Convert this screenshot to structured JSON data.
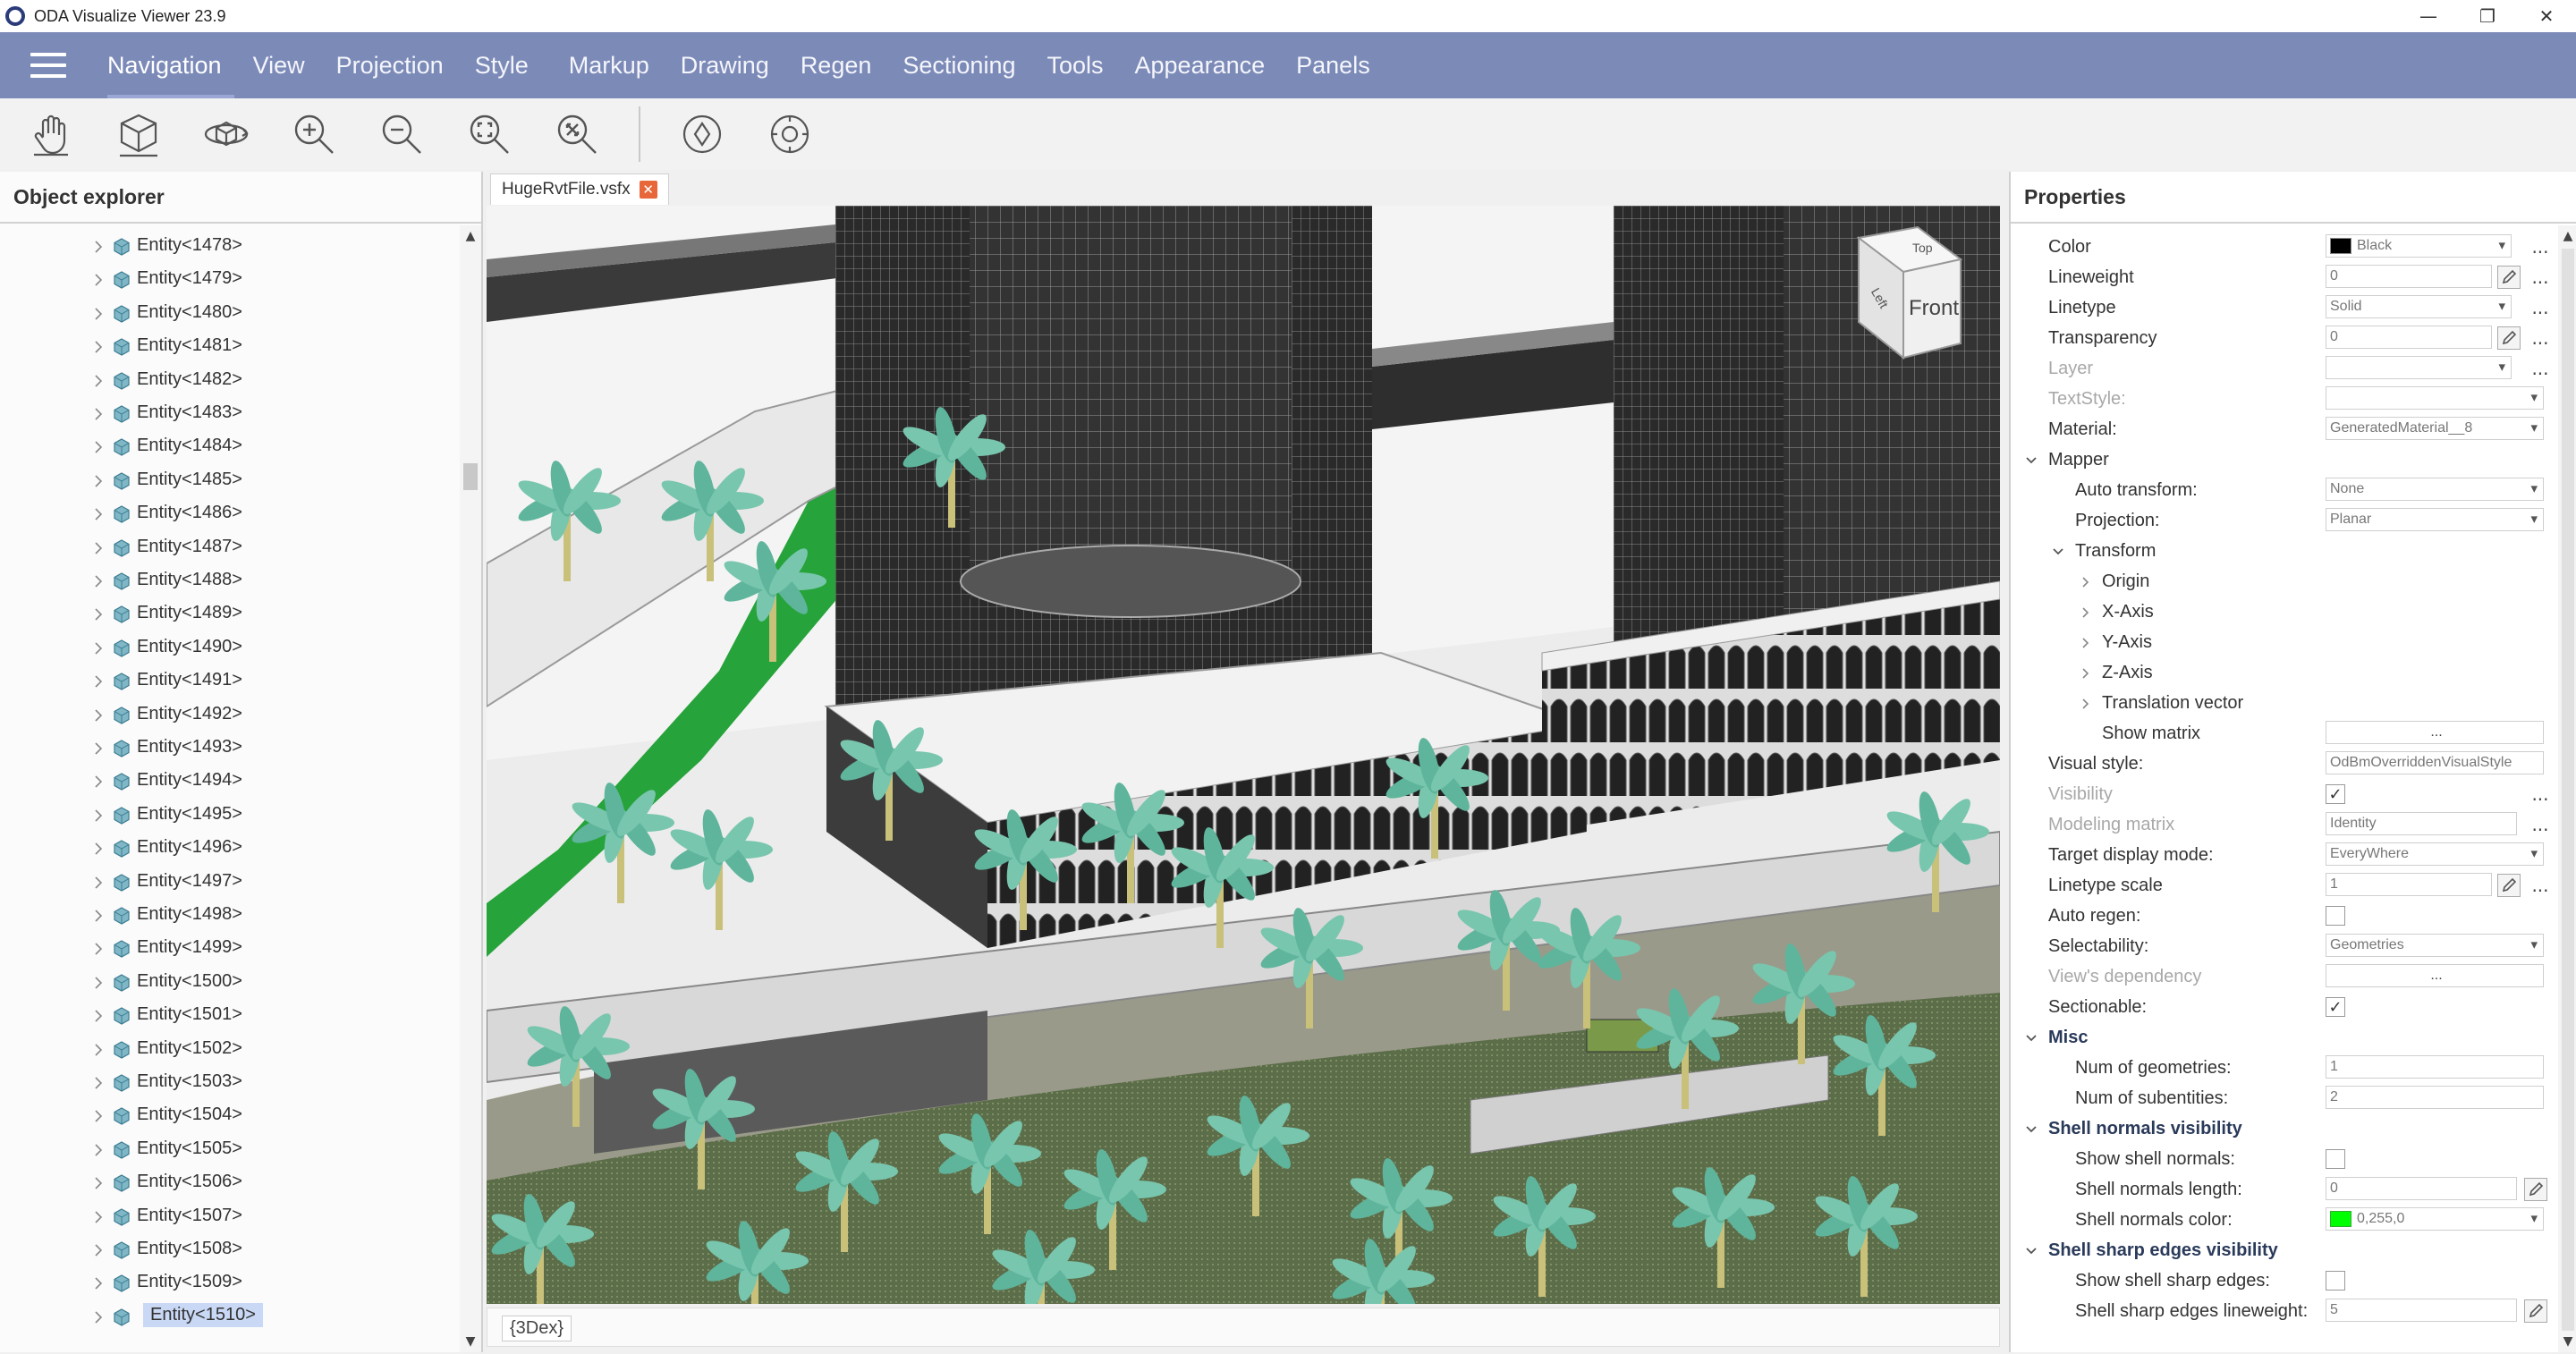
{
  "window": {
    "title": "ODA Visualize Viewer 23.9",
    "controls": {
      "minimize": "—",
      "restore": "❐",
      "close": "✕"
    }
  },
  "menu": {
    "items": [
      "Navigation",
      "View",
      "Projection",
      "Style",
      "Markup",
      "Drawing",
      "Regen",
      "Sectioning",
      "Tools",
      "Appearance",
      "Panels"
    ],
    "active": "Navigation"
  },
  "toolbar": {
    "tools": [
      "pan-hand-icon",
      "3d-box-icon",
      "orbit-icon",
      "zoom-in-icon",
      "zoom-out-icon",
      "zoom-window-icon",
      "zoom-extents-icon",
      "walk-icon",
      "turntable-icon"
    ]
  },
  "object_explorer": {
    "title": "Object explorer",
    "items": [
      "Entity<1478>",
      "Entity<1479>",
      "Entity<1480>",
      "Entity<1481>",
      "Entity<1482>",
      "Entity<1483>",
      "Entity<1484>",
      "Entity<1485>",
      "Entity<1486>",
      "Entity<1487>",
      "Entity<1488>",
      "Entity<1489>",
      "Entity<1490>",
      "Entity<1491>",
      "Entity<1492>",
      "Entity<1493>",
      "Entity<1494>",
      "Entity<1495>",
      "Entity<1496>",
      "Entity<1497>",
      "Entity<1498>",
      "Entity<1499>",
      "Entity<1500>",
      "Entity<1501>",
      "Entity<1502>",
      "Entity<1503>",
      "Entity<1504>",
      "Entity<1505>",
      "Entity<1506>",
      "Entity<1507>",
      "Entity<1508>",
      "Entity<1509>",
      "Entity<1510>"
    ],
    "selected": "Entity<1510>"
  },
  "viewport": {
    "tab_label": "HugeRvtFile.vsfx",
    "tab_close": "✕",
    "view_label": "{3Dex}",
    "viewcube": {
      "top": "Top",
      "front": "Front",
      "left": "Left"
    }
  },
  "properties": {
    "title": "Properties",
    "color": {
      "label": "Color",
      "value": "Black"
    },
    "lineweight": {
      "label": "Lineweight",
      "value": "0"
    },
    "linetype": {
      "label": "Linetype",
      "value": "Solid"
    },
    "transparency": {
      "label": "Transparency",
      "value": "0"
    },
    "layer": {
      "label": "Layer",
      "value": ""
    },
    "textstyle": {
      "label": "TextStyle:",
      "value": ""
    },
    "material": {
      "label": "Material:",
      "value": "GeneratedMaterial__8"
    },
    "mapper": {
      "label": "Mapper"
    },
    "auto_transform": {
      "label": "Auto transform:",
      "value": "None"
    },
    "projection": {
      "label": "Projection:",
      "value": "Planar"
    },
    "transform": {
      "label": "Transform"
    },
    "origin": {
      "label": "Origin"
    },
    "x_axis": {
      "label": "X-Axis"
    },
    "y_axis": {
      "label": "Y-Axis"
    },
    "z_axis": {
      "label": "Z-Axis"
    },
    "translation_vector": {
      "label": "Translation vector"
    },
    "show_matrix": {
      "label": "Show matrix",
      "value": "..."
    },
    "visual_style": {
      "label": "Visual style:",
      "value": "OdBmOverriddenVisualStyle"
    },
    "visibility": {
      "label": "Visibility",
      "checked": "✓"
    },
    "modeling_matrix": {
      "label": "Modeling matrix",
      "value": "Identity"
    },
    "target_display_mode": {
      "label": "Target display mode:",
      "value": "EveryWhere"
    },
    "linetype_scale": {
      "label": "Linetype scale",
      "value": "1"
    },
    "auto_regen": {
      "label": "Auto regen:",
      "checked": ""
    },
    "selectability": {
      "label": "Selectability:",
      "value": "Geometries"
    },
    "views_dependency": {
      "label": "View's dependency",
      "value": "..."
    },
    "sectionable": {
      "label": "Sectionable:",
      "checked": "✓"
    },
    "misc": {
      "label": "Misc"
    },
    "num_geometries": {
      "label": "Num of geometries:",
      "value": "1"
    },
    "num_subentities": {
      "label": "Num of subentities:",
      "value": "2"
    },
    "shell_normals_visibility": {
      "label": "Shell normals visibility"
    },
    "show_shell_normals": {
      "label": "Show shell normals:",
      "checked": ""
    },
    "shell_normals_length": {
      "label": "Shell normals length:",
      "value": "0"
    },
    "shell_normals_color": {
      "label": "Shell normals color:",
      "value": "0,255,0"
    },
    "shell_sharp_edges_visibility": {
      "label": "Shell sharp edges visibility"
    },
    "show_shell_sharp_edges": {
      "label": "Show shell sharp edges:",
      "checked": ""
    },
    "shell_sharp_edges_lineweight": {
      "label": "Shell sharp edges lineweight:",
      "value": "5"
    },
    "dots": "..."
  },
  "colors": {
    "menubar": "#7c8ab8",
    "selection": "#c9d8f5",
    "tab_close": "#e8673a",
    "black_swatch": "#000000",
    "green_swatch": "#00ff00"
  }
}
